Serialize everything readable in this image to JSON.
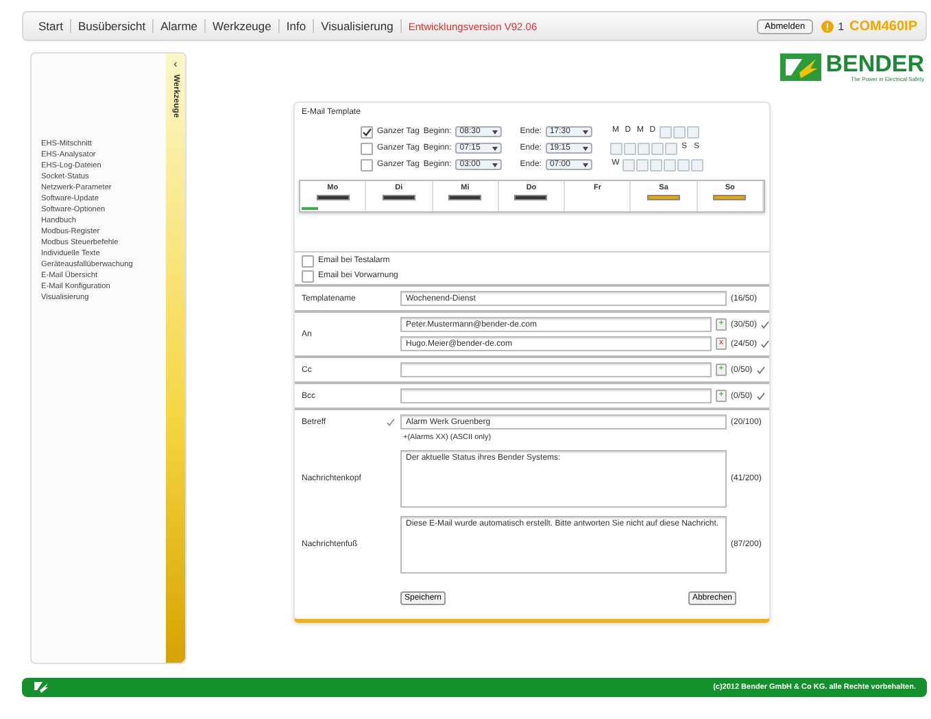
{
  "nav": {
    "items": [
      {
        "label": "Start"
      },
      {
        "label": "Busübersicht"
      },
      {
        "label": "Alarme"
      },
      {
        "label": "Werkzeuge"
      },
      {
        "label": "Info"
      },
      {
        "label": "Visualisierung"
      }
    ],
    "version": "Entwicklungsversion V92.06",
    "logout": "Abmelden",
    "alarm_count": "1",
    "device": "COM460IP"
  },
  "logo": {
    "name": "BENDER",
    "tagline": "The Power in Electrical Safety"
  },
  "sidebar": {
    "tab": "Werkzeuge",
    "collapse": "‹",
    "items": [
      {
        "label": "EHS-Mitschnitt"
      },
      {
        "label": "EHS-Analysator"
      },
      {
        "label": "EHS-Log-Dateien"
      },
      {
        "label": "Socket-Status"
      },
      {
        "label": "Netzwerk-Parameter"
      },
      {
        "label": "Software-Update"
      },
      {
        "label": "Software-Optionen"
      },
      {
        "label": "Handbuch"
      },
      {
        "label": "Modbus-Register"
      },
      {
        "label": "Modbus Steuerbefehle"
      },
      {
        "label": "Individuelle Texte"
      },
      {
        "label": "Geräteausfallüberwachung"
      },
      {
        "label": "E-Mail Übersicht"
      },
      {
        "label": "E-Mail Konfiguration"
      },
      {
        "label": "Visualisierung"
      }
    ]
  },
  "panel": {
    "title": "E-Mail Template",
    "schedule": [
      {
        "whole_day": true,
        "whole_day_label": "Ganzer Tag",
        "begin_label": "Beginn:",
        "begin": "08:30",
        "end_label": "Ende:",
        "end": "17:30",
        "days": [
          {
            "kind": "letter",
            "label": "M"
          },
          {
            "kind": "letter",
            "label": "D"
          },
          {
            "kind": "letter",
            "label": "M"
          },
          {
            "kind": "letter",
            "label": "D"
          },
          {
            "kind": "box"
          },
          {
            "kind": "box"
          },
          {
            "kind": "box"
          }
        ]
      },
      {
        "whole_day": false,
        "whole_day_label": "Ganzer Tag",
        "begin_label": "Beginn:",
        "begin": "07:15",
        "end_label": "Ende:",
        "end": "19:15",
        "days": [
          {
            "kind": "box"
          },
          {
            "kind": "box"
          },
          {
            "kind": "box"
          },
          {
            "kind": "box"
          },
          {
            "kind": "box"
          },
          {
            "kind": "letter",
            "label": "S"
          },
          {
            "kind": "letter",
            "label": "S"
          }
        ]
      },
      {
        "whole_day": false,
        "whole_day_label": "Ganzer Tag",
        "begin_label": "Beginn:",
        "begin": "03:00",
        "end_label": "Ende:",
        "end": "07:00",
        "days": [
          {
            "kind": "letter",
            "label": "W"
          },
          {
            "kind": "box"
          },
          {
            "kind": "box"
          },
          {
            "kind": "box"
          },
          {
            "kind": "box"
          },
          {
            "kind": "box"
          },
          {
            "kind": "box"
          }
        ]
      }
    ],
    "week": [
      {
        "label": "Mo",
        "color": "#333333",
        "today": true
      },
      {
        "label": "Di",
        "color": "#333333",
        "today": false
      },
      {
        "label": "Mi",
        "color": "#333333",
        "today": false
      },
      {
        "label": "Do",
        "color": "#333333",
        "today": false
      },
      {
        "label": "Fr",
        "today": false
      },
      {
        "label": "Sa",
        "color": "#e8a800",
        "today": false
      },
      {
        "label": "So",
        "color": "#e8a800",
        "today": false
      }
    ],
    "options": [
      {
        "label": "Email bei Testalarm",
        "checked": false
      },
      {
        "label": "Email bei Vorwarnung",
        "checked": false
      }
    ],
    "fields": [
      {
        "kind": "input",
        "label": "Templatename",
        "value": "Wochenend-Dienst",
        "count": "(16/50)",
        "valid": false
      },
      {
        "kind": "recipients",
        "label": "An",
        "entries": [
          {
            "value": "Peter.Mustermann@bender-de.com",
            "kind": "add",
            "button": "+",
            "count": "(30/50)",
            "valid": true
          },
          {
            "value": "Hugo.Meier@bender-de.com",
            "kind": "remove",
            "button": "x",
            "count": "(24/50)",
            "valid": true
          }
        ]
      },
      {
        "kind": "recipients",
        "label": "Cc",
        "entries": [
          {
            "kind": "add",
            "button": "+",
            "count": "(0/50)",
            "valid": true
          }
        ]
      },
      {
        "kind": "recipients",
        "label": "Bcc",
        "entries": [
          {
            "kind": "add",
            "button": "+",
            "count": "(0/50)",
            "valid": true
          }
        ]
      },
      {
        "kind": "input",
        "label": "Betreff",
        "value": "Alarm Werk Gruenberg",
        "count": "(20/100)",
        "valid": true,
        "hint": "+(Alarms XX) (ASCII only)"
      },
      {
        "kind": "textarea",
        "label": "Nachrichtenkopf",
        "value": "Der aktuelle Status ihres Bender Systems:",
        "count": "(41/200)"
      },
      {
        "kind": "textarea",
        "label": "Nachrichtenfuß",
        "value": "Diese E-Mail wurde automatisch erstellt. Bitte antworten Sie nicht auf diese Nachricht.",
        "count": "(87/200)"
      }
    ],
    "buttons": [
      {
        "label": "Speichern"
      },
      {
        "label": "Abbrechen"
      }
    ]
  },
  "footer": {
    "copyright": "(c)2012 Bender GmbH & Co KG. alle Rechte vorbehalten."
  }
}
